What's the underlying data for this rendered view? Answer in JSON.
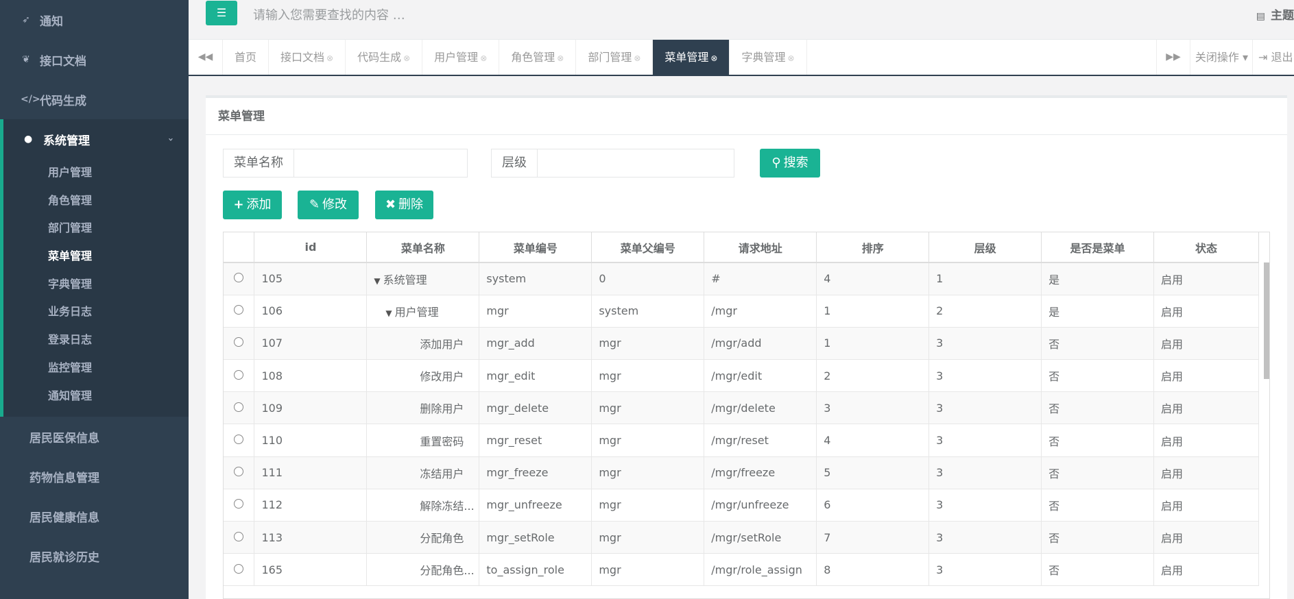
{
  "sidebar": {
    "top_items": [
      {
        "label": "通知",
        "icon": "rocket-icon"
      },
      {
        "label": "接口文档",
        "icon": "leaf-icon"
      },
      {
        "label": "代码生成",
        "icon": "code-icon"
      }
    ],
    "group": {
      "label": "系统管理",
      "icon": "user-icon",
      "items": [
        "用户管理",
        "角色管理",
        "部门管理",
        "菜单管理",
        "字典管理",
        "业务日志",
        "登录日志",
        "监控管理",
        "通知管理"
      ],
      "active": "菜单管理"
    },
    "bottom_items": [
      "居民医保信息",
      "药物信息管理",
      "居民健康信息",
      "居民就诊历史"
    ]
  },
  "topbar": {
    "search_placeholder": "请输入您需要查找的内容 …",
    "theme_label": "主题"
  },
  "tabs": {
    "items": [
      "首页",
      "接口文档",
      "代码生成",
      "用户管理",
      "角色管理",
      "部门管理",
      "菜单管理",
      "字典管理"
    ],
    "active": "菜单管理",
    "close_ops_label": "关闭操作",
    "logout_label": "退出"
  },
  "panel": {
    "title": "菜单管理",
    "filters": {
      "menu_name_label": "菜单名称",
      "level_label": "层级"
    },
    "search_button": "搜索",
    "add_button": "添加",
    "edit_button": "修改",
    "delete_button": "删除"
  },
  "table": {
    "columns": [
      "id",
      "菜单名称",
      "菜单编号",
      "菜单父编号",
      "请求地址",
      "排序",
      "层级",
      "是否是菜单",
      "状态"
    ],
    "rows": [
      {
        "id": "105",
        "name": "系统管理",
        "code": "system",
        "pcode": "0",
        "url": "#",
        "sort": "4",
        "level": "1",
        "ismenu": "是",
        "status": "启用",
        "indent": 0,
        "expander": true
      },
      {
        "id": "106",
        "name": "用户管理",
        "code": "mgr",
        "pcode": "system",
        "url": "/mgr",
        "sort": "1",
        "level": "2",
        "ismenu": "是",
        "status": "启用",
        "indent": 1,
        "expander": true
      },
      {
        "id": "107",
        "name": "添加用户",
        "code": "mgr_add",
        "pcode": "mgr",
        "url": "/mgr/add",
        "sort": "1",
        "level": "3",
        "ismenu": "否",
        "status": "启用",
        "indent": 2,
        "expander": false
      },
      {
        "id": "108",
        "name": "修改用户",
        "code": "mgr_edit",
        "pcode": "mgr",
        "url": "/mgr/edit",
        "sort": "2",
        "level": "3",
        "ismenu": "否",
        "status": "启用",
        "indent": 2,
        "expander": false
      },
      {
        "id": "109",
        "name": "删除用户",
        "code": "mgr_delete",
        "pcode": "mgr",
        "url": "/mgr/delete",
        "sort": "3",
        "level": "3",
        "ismenu": "否",
        "status": "启用",
        "indent": 2,
        "expander": false
      },
      {
        "id": "110",
        "name": "重置密码",
        "code": "mgr_reset",
        "pcode": "mgr",
        "url": "/mgr/reset",
        "sort": "4",
        "level": "3",
        "ismenu": "否",
        "status": "启用",
        "indent": 2,
        "expander": false
      },
      {
        "id": "111",
        "name": "冻结用户",
        "code": "mgr_freeze",
        "pcode": "mgr",
        "url": "/mgr/freeze",
        "sort": "5",
        "level": "3",
        "ismenu": "否",
        "status": "启用",
        "indent": 2,
        "expander": false
      },
      {
        "id": "112",
        "name": "解除冻结...",
        "code": "mgr_unfreeze",
        "pcode": "mgr",
        "url": "/mgr/unfreeze",
        "sort": "6",
        "level": "3",
        "ismenu": "否",
        "status": "启用",
        "indent": 2,
        "expander": false
      },
      {
        "id": "113",
        "name": "分配角色",
        "code": "mgr_setRole",
        "pcode": "mgr",
        "url": "/mgr/setRole",
        "sort": "7",
        "level": "3",
        "ismenu": "否",
        "status": "启用",
        "indent": 2,
        "expander": false
      },
      {
        "id": "165",
        "name": "分配角色...",
        "code": "to_assign_role",
        "pcode": "mgr",
        "url": "/mgr/role_assign",
        "sort": "8",
        "level": "3",
        "ismenu": "否",
        "status": "启用",
        "indent": 2,
        "expander": false
      }
    ]
  },
  "colors": {
    "accent": "#1ab394",
    "sidebar_bg": "#2f4050",
    "sidebar_group_bg": "#293846"
  }
}
